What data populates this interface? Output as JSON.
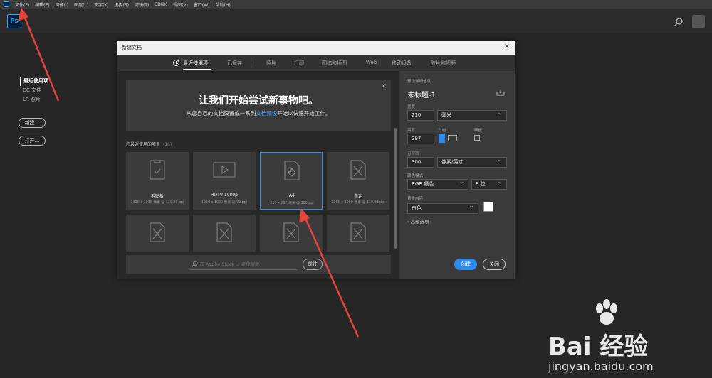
{
  "menubar": {
    "items": [
      "文件(F)",
      "编辑(E)",
      "图像(I)",
      "图层(L)",
      "文字(Y)",
      "选择(S)",
      "滤镜(T)",
      "3D(D)",
      "视图(V)",
      "窗口(W)",
      "帮助(H)"
    ]
  },
  "app": {
    "logo": "Ps"
  },
  "leftnav": {
    "items": [
      "最近使用项",
      "CC 文件",
      "LR 照片"
    ],
    "new_button": "新建...",
    "open_button": "打开..."
  },
  "dialog": {
    "title": "新建文档",
    "tabs": [
      "最近使用项",
      "已保存",
      "照片",
      "打印",
      "图稿和插图",
      "Web",
      "移动设备",
      "胶片和视频"
    ],
    "banner": {
      "title": "让我们开始尝试新事物吧。",
      "sub_before": "从您自己的文档设置或一系列",
      "sub_link": "文档预设",
      "sub_after": "开始以快速开始工作。"
    },
    "recent_label": "您最近使用的项目",
    "recent_count": "(16)",
    "cards": [
      {
        "name": "剪贴板",
        "size": "1920 x 1039 像素 @ 119.99 ppi",
        "icon": "clipboard-doc-icon"
      },
      {
        "name": "HDTV 1080p",
        "size": "1920 x 1080 像素 @ 72 ppi",
        "icon": "video-doc-icon"
      },
      {
        "name": "A4",
        "size": "210 x 297 毫米 @ 300 ppi",
        "icon": "print-doc-icon"
      },
      {
        "name": "自定",
        "size": "1080 x 1080 像素 @ 119.99 ppi",
        "icon": "custom-doc-icon"
      }
    ],
    "stock": {
      "placeholder": "在 Adobe Stock 上查找模板",
      "go": "前往"
    },
    "details": {
      "section_label": "预设详细信息",
      "doc_title": "未标题-1",
      "width_label": "宽度",
      "width_value": "210",
      "width_unit": "毫米",
      "height_label": "高度",
      "height_value": "297",
      "orientation_label": "方向",
      "artboard_label": "画板",
      "resolution_label": "分辨率",
      "resolution_value": "300",
      "resolution_unit": "像素/英寸",
      "color_mode_label": "颜色模式",
      "color_mode_value": "RGB 颜色",
      "bit_depth_value": "8 位",
      "background_label": "背景内容",
      "background_value": "白色",
      "advanced": "高级选项",
      "create": "创建",
      "close": "关闭"
    }
  },
  "watermark": {
    "brand": "Bai 经验",
    "url": "jingyan.baidu.com"
  },
  "colors": {
    "accent": "#2d8ceb",
    "ps_blue": "#31a8ff",
    "annotation_arrow": "#e8443a"
  }
}
